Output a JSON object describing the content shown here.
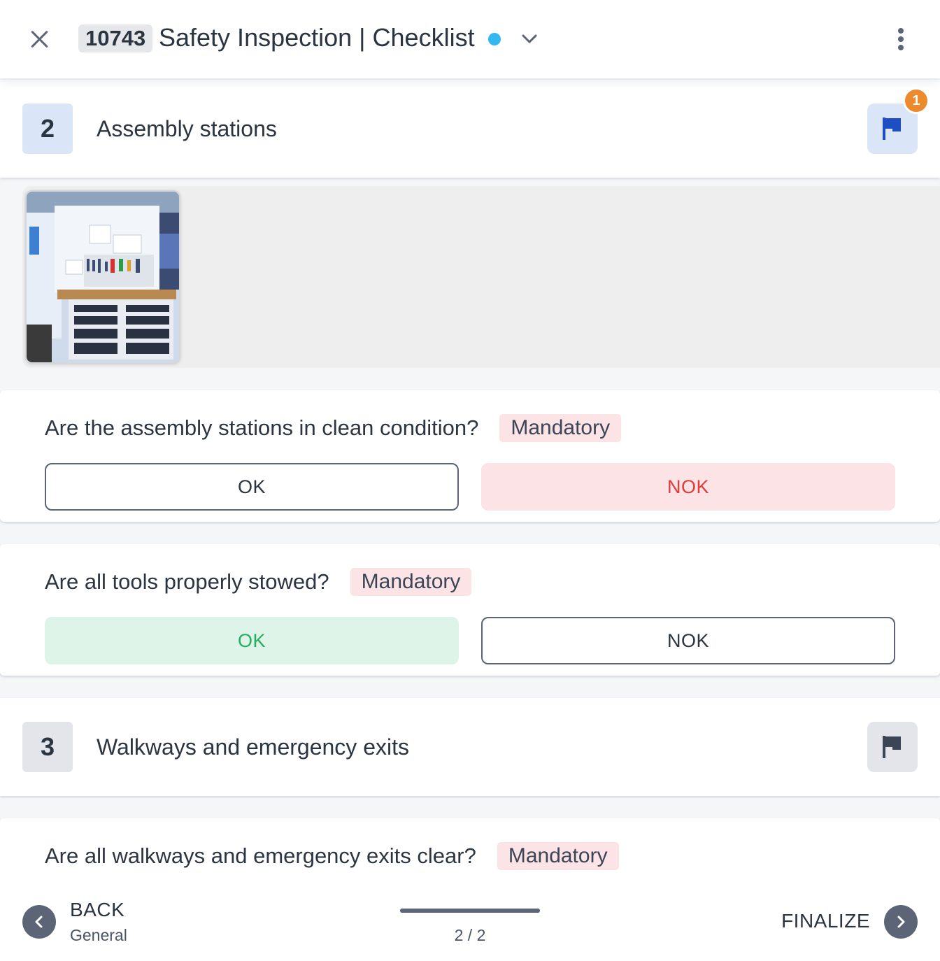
{
  "header": {
    "id": "10743",
    "title": "Safety Inspection | Checklist",
    "status_color": "#34b8f2",
    "icons": {
      "close": "close-icon",
      "expand": "chevron-down-icon",
      "menu": "more-vertical-icon"
    }
  },
  "sections": [
    {
      "number": "2",
      "title": "Assembly stations",
      "flag_badge": "1",
      "flag_active": true,
      "photo": {
        "icon": "workbench-photo"
      },
      "questions": [
        {
          "text": "Are the assembly stations in clean condition?",
          "tag": "Mandatory",
          "ok_label": "OK",
          "nok_label": "NOK",
          "selected": "NOK"
        },
        {
          "text": "Are all tools properly stowed?",
          "tag": "Mandatory",
          "ok_label": "OK",
          "nok_label": "NOK",
          "selected": "OK"
        }
      ]
    },
    {
      "number": "3",
      "title": "Walkways and emergency exits",
      "flag_active": false,
      "questions": [
        {
          "text": "Are all walkways and emergency exits clear?",
          "tag": "Mandatory"
        }
      ]
    }
  ],
  "footer": {
    "back_label": "BACK",
    "back_sub": "General",
    "page_count": "2 / 2",
    "progress": 1.0,
    "finalize_label": "FINALIZE"
  },
  "colors": {
    "accent": "#1e4fc2",
    "accent_bg": "#dbe5f8",
    "neutral_bg": "#e3e5ea",
    "badge": "#ee8a2e",
    "ok": "#22b060",
    "ok_bg": "#def4e8",
    "nok": "#e23b3b",
    "nok_bg": "#fbe3e6"
  }
}
